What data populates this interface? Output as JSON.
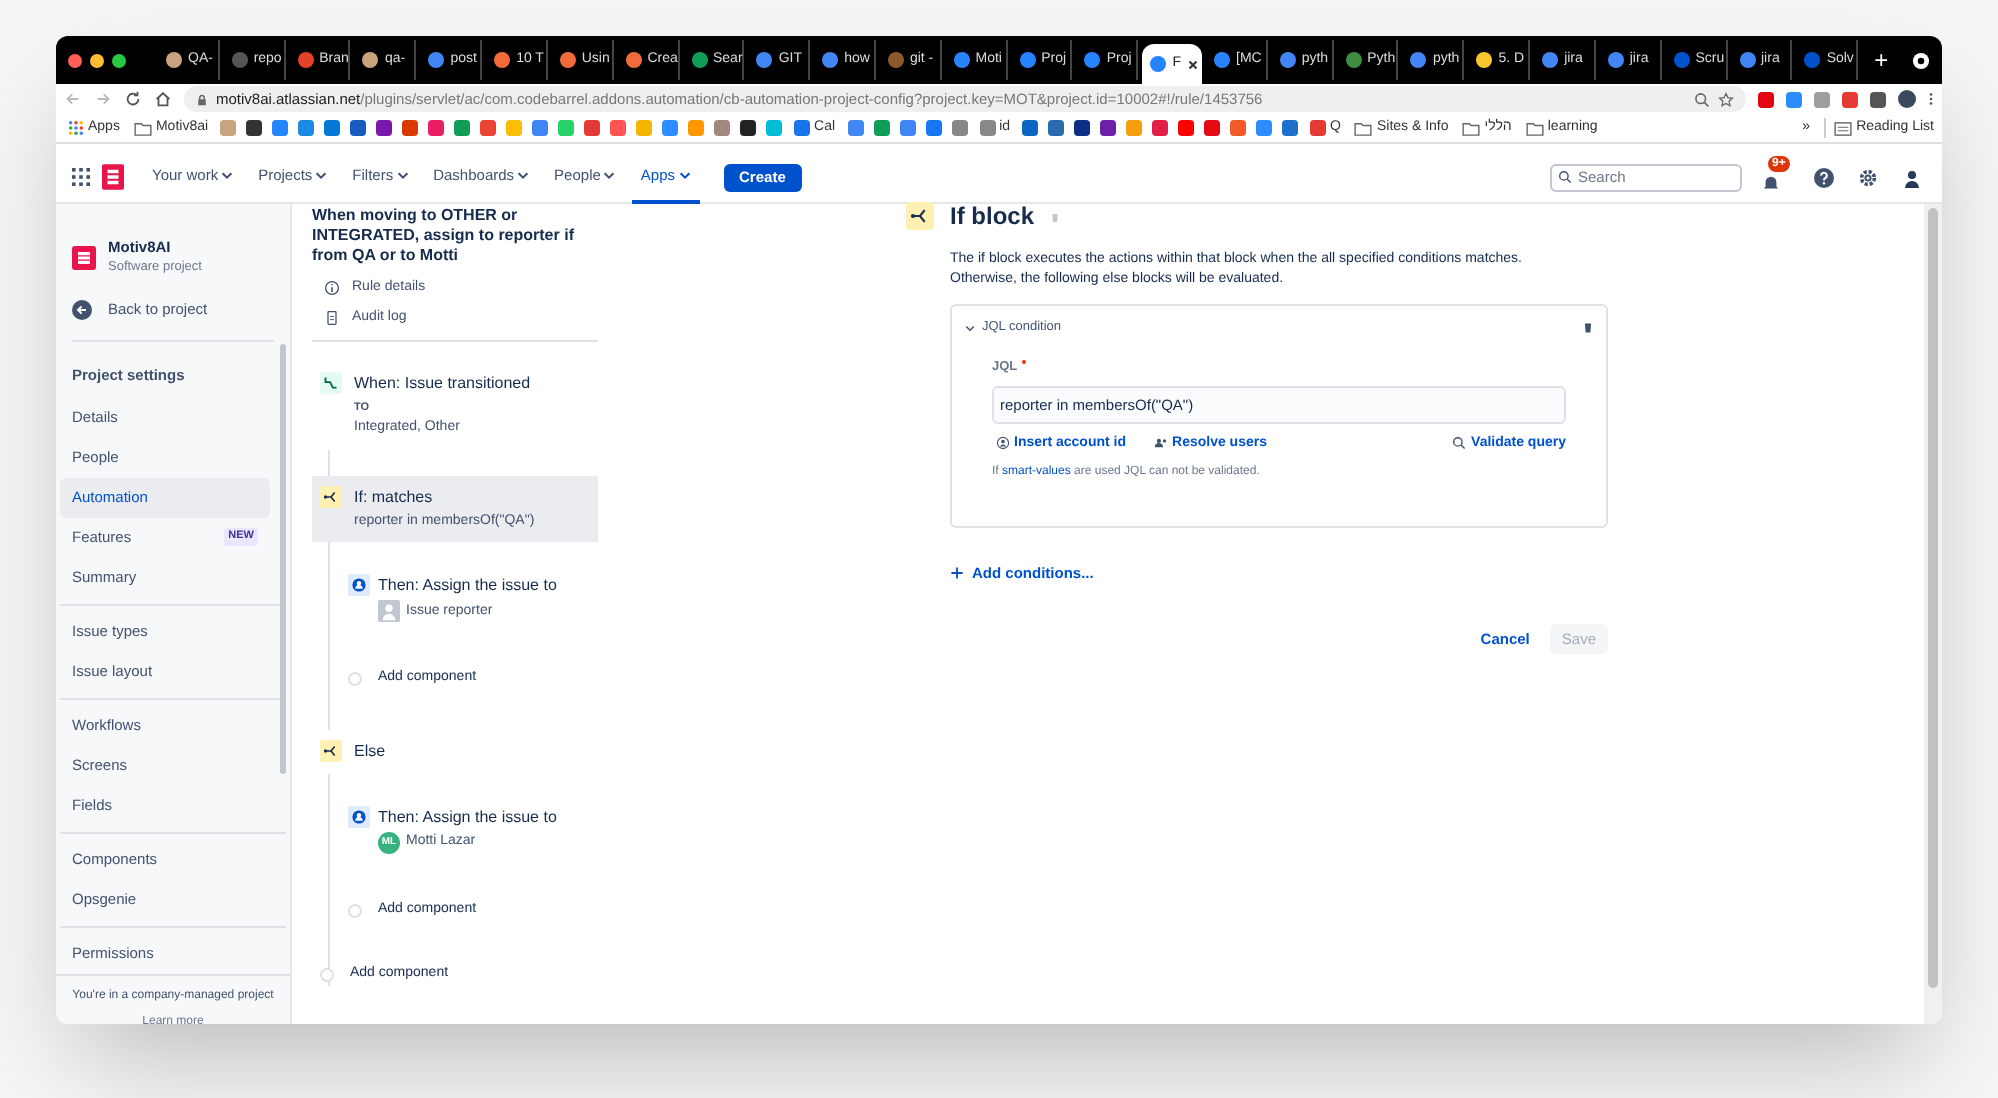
{
  "browser": {
    "tabs": [
      {
        "label": "QA-",
        "color": "#c9a27e",
        "selected": false
      },
      {
        "label": "repo",
        "color": "#555555",
        "selected": false
      },
      {
        "label": "Bran",
        "color": "#e24329",
        "selected": false
      },
      {
        "label": "qa-",
        "color": "#c9a27e",
        "selected": false
      },
      {
        "label": "post",
        "color": "#4285f4",
        "selected": false
      },
      {
        "label": "10 T",
        "color": "#f26b3a",
        "selected": false
      },
      {
        "label": "Usin",
        "color": "#f26b3a",
        "selected": false
      },
      {
        "label": "Crea",
        "color": "#f26b3a",
        "selected": false
      },
      {
        "label": "Sear",
        "color": "#0f9d58",
        "selected": false
      },
      {
        "label": "GIT",
        "color": "#4285f4",
        "selected": false
      },
      {
        "label": "how",
        "color": "#4285f4",
        "selected": false
      },
      {
        "label": "git -",
        "color": "#8b5a2b",
        "selected": false
      },
      {
        "label": "Moti",
        "color": "#2684ff",
        "selected": false
      },
      {
        "label": "Proj",
        "color": "#2684ff",
        "selected": false
      },
      {
        "label": "Proj",
        "color": "#2684ff",
        "selected": false
      },
      {
        "label": "F",
        "color": "#2684ff",
        "selected": true
      },
      {
        "label": "[MC",
        "color": "#2684ff",
        "selected": false
      },
      {
        "label": "pyth",
        "color": "#4285f4",
        "selected": false
      },
      {
        "label": "Pyth",
        "color": "#3c8d40",
        "selected": false
      },
      {
        "label": "pyth",
        "color": "#4285f4",
        "selected": false
      },
      {
        "label": "5. D",
        "color": "#f7c62f",
        "selected": false
      },
      {
        "label": "jira",
        "color": "#4285f4",
        "selected": false
      },
      {
        "label": "jira",
        "color": "#4285f4",
        "selected": false
      },
      {
        "label": "Scru",
        "color": "#0052cc",
        "selected": false
      },
      {
        "label": "jira",
        "color": "#4285f4",
        "selected": false
      },
      {
        "label": "Solv",
        "color": "#0052cc",
        "selected": false
      }
    ],
    "new_tab": "+",
    "url": {
      "host": "motiv8ai.atlassian.net",
      "path": "/plugins/servlet/ac/com.codebarrel.addons.automation/cb-automation-project-config?project.key=MOT&project.id=10002#!/rule/1453756"
    },
    "bookmarks": [
      {
        "kind": "apps",
        "label": "Apps"
      },
      {
        "kind": "folder",
        "label": "Motiv8ai"
      },
      {
        "kind": "icon",
        "color": "#c9a27e"
      },
      {
        "kind": "icon",
        "color": "#333333"
      },
      {
        "kind": "icon",
        "color": "#2684ff"
      },
      {
        "kind": "icon",
        "color": "#1e88e5"
      },
      {
        "kind": "icon",
        "color": "#0078d4"
      },
      {
        "kind": "icon",
        "color": "#185abd"
      },
      {
        "kind": "icon",
        "color": "#7719aa"
      },
      {
        "kind": "icon",
        "color": "#d83b01"
      },
      {
        "kind": "icon",
        "color": "#e91e63"
      },
      {
        "kind": "icon",
        "color": "#0f9d58"
      },
      {
        "kind": "icon",
        "color": "#ea4335"
      },
      {
        "kind": "icon",
        "color": "#fbbc04"
      },
      {
        "kind": "icon",
        "color": "#4285f4"
      },
      {
        "kind": "icon",
        "color": "#25d366"
      },
      {
        "kind": "icon",
        "color": "#e53935"
      },
      {
        "kind": "icon",
        "color": "#ff5252"
      },
      {
        "kind": "icon",
        "color": "#f4b400"
      },
      {
        "kind": "icon",
        "color": "#2d8cff"
      },
      {
        "kind": "icon",
        "color": "#ff9800"
      },
      {
        "kind": "icon",
        "color": "#a1887f"
      },
      {
        "kind": "icon",
        "color": "#222222"
      },
      {
        "kind": "icon",
        "color": "#00bcd4"
      },
      {
        "kind": "labeled",
        "label": "Cal",
        "color": "#1a73e8"
      },
      {
        "kind": "icon",
        "color": "#4285f4"
      },
      {
        "kind": "icon",
        "color": "#0f9d58"
      },
      {
        "kind": "icon",
        "color": "#4285f4"
      },
      {
        "kind": "icon",
        "color": "#1877f2"
      },
      {
        "kind": "icon",
        "color": "#888888"
      },
      {
        "kind": "labeled",
        "label": "id",
        "color": "#888888"
      },
      {
        "kind": "icon",
        "color": "#0a66c2"
      },
      {
        "kind": "icon",
        "color": "#2b6cb0"
      },
      {
        "kind": "icon",
        "color": "#0c2d83"
      },
      {
        "kind": "icon",
        "color": "#6b21a8"
      },
      {
        "kind": "icon",
        "color": "#f59e0b"
      },
      {
        "kind": "icon",
        "color": "#e11d48"
      },
      {
        "kind": "icon",
        "color": "#ff0000"
      },
      {
        "kind": "icon",
        "color": "#e50914"
      },
      {
        "kind": "icon",
        "color": "#f05a28"
      },
      {
        "kind": "icon",
        "color": "#2d8cff"
      },
      {
        "kind": "icon",
        "color": "#1e6ecb"
      },
      {
        "kind": "labeled",
        "label": "Q",
        "color": "#e53935"
      },
      {
        "kind": "folder",
        "label": "Sites & Info"
      },
      {
        "kind": "folder",
        "label": "הללי"
      },
      {
        "kind": "folder",
        "label": "learning"
      }
    ],
    "bookmarks_more": "»",
    "reading_list": "Reading List"
  },
  "nav": {
    "items": [
      {
        "label": "Your work",
        "selected": false
      },
      {
        "label": "Projects",
        "selected": false
      },
      {
        "label": "Filters",
        "selected": false
      },
      {
        "label": "Dashboards",
        "selected": false
      },
      {
        "label": "People",
        "selected": false
      },
      {
        "label": "Apps",
        "selected": true
      }
    ],
    "create": "Create",
    "search_placeholder": "Search",
    "notifications": "9+"
  },
  "sidebar": {
    "project": "Motiv8AI",
    "project_type": "Software project",
    "back": "Back to project",
    "heading": "Project settings",
    "groups": [
      [
        {
          "label": "Details",
          "selected": false
        },
        {
          "label": "People",
          "selected": false
        },
        {
          "label": "Automation",
          "selected": true
        },
        {
          "label": "Features",
          "selected": false,
          "badge": "NEW"
        },
        {
          "label": "Summary",
          "selected": false
        }
      ],
      [
        {
          "label": "Issue types",
          "selected": false
        },
        {
          "label": "Issue layout",
          "selected": false
        }
      ],
      [
        {
          "label": "Workflows",
          "selected": false
        },
        {
          "label": "Screens",
          "selected": false
        },
        {
          "label": "Fields",
          "selected": false
        }
      ],
      [
        {
          "label": "Components",
          "selected": false
        },
        {
          "label": "Opsgenie",
          "selected": false
        }
      ],
      [
        {
          "label": "Permissions",
          "selected": false
        }
      ]
    ],
    "footer": "You're in a company-managed project",
    "learn_more": "Learn more"
  },
  "rule": {
    "title": "When moving to OTHER or INTEGRATED, assign to reporter if from QA or to Motti",
    "links": [
      {
        "kind": "info",
        "label": "Rule details"
      },
      {
        "kind": "log",
        "label": "Audit log"
      }
    ],
    "components": [
      {
        "kind": "trigger",
        "title": "When: Issue transitioned",
        "lines": [
          "TO",
          "Integrated, Other"
        ],
        "selected": false
      },
      {
        "kind": "condition",
        "title": "If: matches",
        "lines": [
          "reporter in membersOf(\"QA\")"
        ],
        "selected": true
      },
      {
        "kind": "action",
        "title": "Then: Assign the issue to",
        "assignee": {
          "kind": "generic",
          "name": "Issue reporter"
        }
      },
      {
        "kind": "add",
        "title": "Add component"
      },
      {
        "kind": "else",
        "title": "Else",
        "selected": false
      },
      {
        "kind": "action",
        "title": "Then: Assign the issue to",
        "assignee": {
          "kind": "initials",
          "initials": "ML",
          "name": "Motti Lazar"
        }
      },
      {
        "kind": "add",
        "title": "Add component"
      },
      {
        "kind": "add_outer",
        "title": "Add component"
      }
    ]
  },
  "editor": {
    "title": "If block",
    "description": "The if block executes the actions within that block when the all specified conditions matches. Otherwise, the following else blocks will be evaluated.",
    "condition": {
      "title": "JQL condition",
      "expanded": true,
      "field_label": "JQL",
      "required": true,
      "value": "reporter in membersOf(\"QA\")",
      "actions": [
        "Insert account id",
        "Resolve users"
      ],
      "validate": "Validate query",
      "hint": "If **smart-values** are used JQL can not be validated."
    },
    "add_conditions": "Add conditions...",
    "cancel": "Cancel",
    "save": {
      "label": "Save",
      "disabled": true
    }
  }
}
